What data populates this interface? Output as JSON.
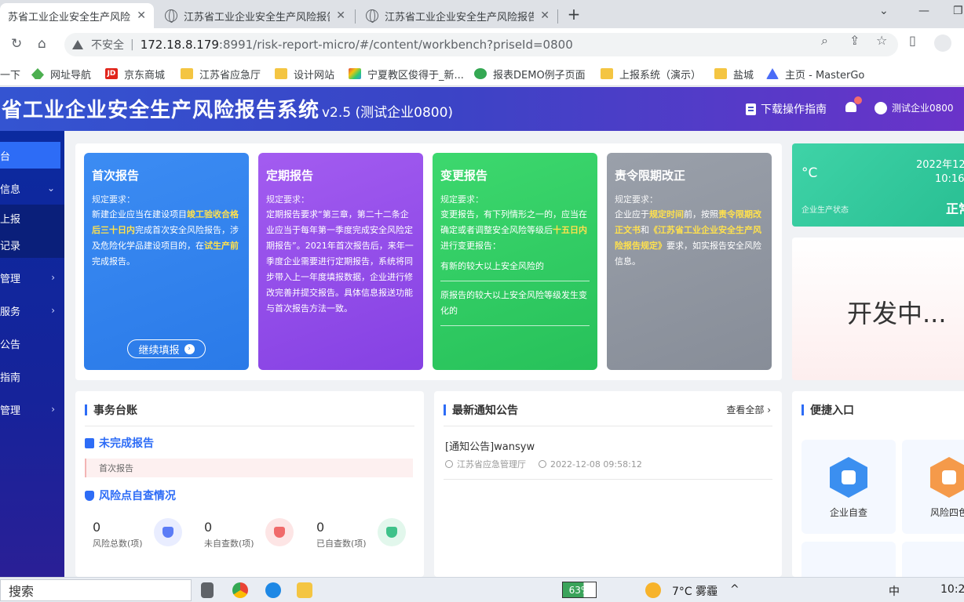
{
  "browser": {
    "tabs": [
      {
        "title": "苏省工业企业安全生产风险报告"
      },
      {
        "title": "江苏省工业企业安全生产风险报告"
      },
      {
        "title": "江苏省工业企业安全生产风险报告"
      }
    ],
    "insecure_label": "不安全",
    "url_host": "172.18.8.179",
    "url_path": ":8991/risk-report-micro/#/content/workbench?priseId=0800",
    "bookmarks": [
      "一下",
      "网址导航",
      "京东商城",
      "江苏省应急厅",
      "设计网站",
      "宁夏教区俊得于_新...",
      "报表DEMO例子页面",
      "上报系统（演示）",
      "盐城",
      "主页 - MasterGo"
    ]
  },
  "header": {
    "title": "省工业企业安全生产风险报告系统",
    "version": "v2.5",
    "company": "(测试企业0800)",
    "guide_link": "下载操作指南",
    "notification_count": "1",
    "user": "测试企业0800"
  },
  "sidebar": {
    "items": [
      {
        "label": "台"
      },
      {
        "label": "信息"
      },
      {
        "label": "上报"
      },
      {
        "label": "记录"
      },
      {
        "label": "管理"
      },
      {
        "label": "服务"
      },
      {
        "label": "公告"
      },
      {
        "label": "指南"
      },
      {
        "label": "管理"
      }
    ]
  },
  "report_cards": [
    {
      "title": "首次报告",
      "req_label": "规定要求：",
      "text_parts": [
        "新建企业应当在建设项目",
        "竣工验收合格后三十日内",
        "完成首次安全风险报告，涉及危险化学品建设项目的，在",
        "试生产前",
        "完成报告。"
      ],
      "button": "继续填报"
    },
    {
      "title": "定期报告",
      "req_label": "规定要求：",
      "text": "定期报告要求“第三章，第二十二条企业应当于每年第一季度完成安全风险定期报告”。2021年首次报告后，来年一季度企业需要进行定期报告，系统将同步带入上一年度填报数据，企业进行修改完善并提交报告。具体信息报送功能与首次报告方法一致。"
    },
    {
      "title": "变更报告",
      "req_label": "规定要求：",
      "text_parts": [
        "变更报告，有下列情形之一的，应当在确定或者调整安全风险等级后",
        "十五日内",
        "进行变更报告："
      ],
      "items": [
        "有新的较大以上安全风险的",
        "原报告的较大以上安全风险等级发生变化的"
      ]
    },
    {
      "title": "责令限期改正",
      "req_label": "规定要求：",
      "text_parts": [
        "企业应于",
        "规定时间",
        "前，按照",
        "责令限期改正文书",
        "和",
        "《江苏省工业企业安全生产风险报告规定》",
        "要求，如实报告安全风险信息。"
      ]
    }
  ],
  "weather": {
    "unit": "°C",
    "date": "2022年12",
    "time": "10:16",
    "label": "企业生产状态",
    "status": "正常"
  },
  "dev_card": {
    "text": "开发中..."
  },
  "affairs": {
    "title": "事务台账",
    "unfinished_title": "未完成报告",
    "pending_item": "首次报告",
    "risk_title": "风险点自查情况",
    "stats": [
      {
        "value": "0",
        "label": "风险总数(项)",
        "color": "#5b7cf6"
      },
      {
        "value": "0",
        "label": "未自查数(项)",
        "color": "#f06a6a"
      },
      {
        "value": "0",
        "label": "已自查数(项)",
        "color": "#3fc28a"
      }
    ]
  },
  "notices": {
    "title": "最新通知公告",
    "more": "查看全部",
    "items": [
      {
        "title": "[通知公告]wansyw",
        "author": "江苏省应急管理厅",
        "time": "2022-12-08 09:58:12"
      }
    ]
  },
  "quick": {
    "title": "便捷入口",
    "items": [
      {
        "label": "企业自查",
        "color": "#3b8ff0"
      },
      {
        "label": "风险四色",
        "color": "#f59a4a"
      }
    ]
  },
  "taskbar": {
    "search_label": "搜索",
    "battery": "63%",
    "weather": "7°C 雾霾",
    "ime": "中",
    "clock": "10:2"
  }
}
